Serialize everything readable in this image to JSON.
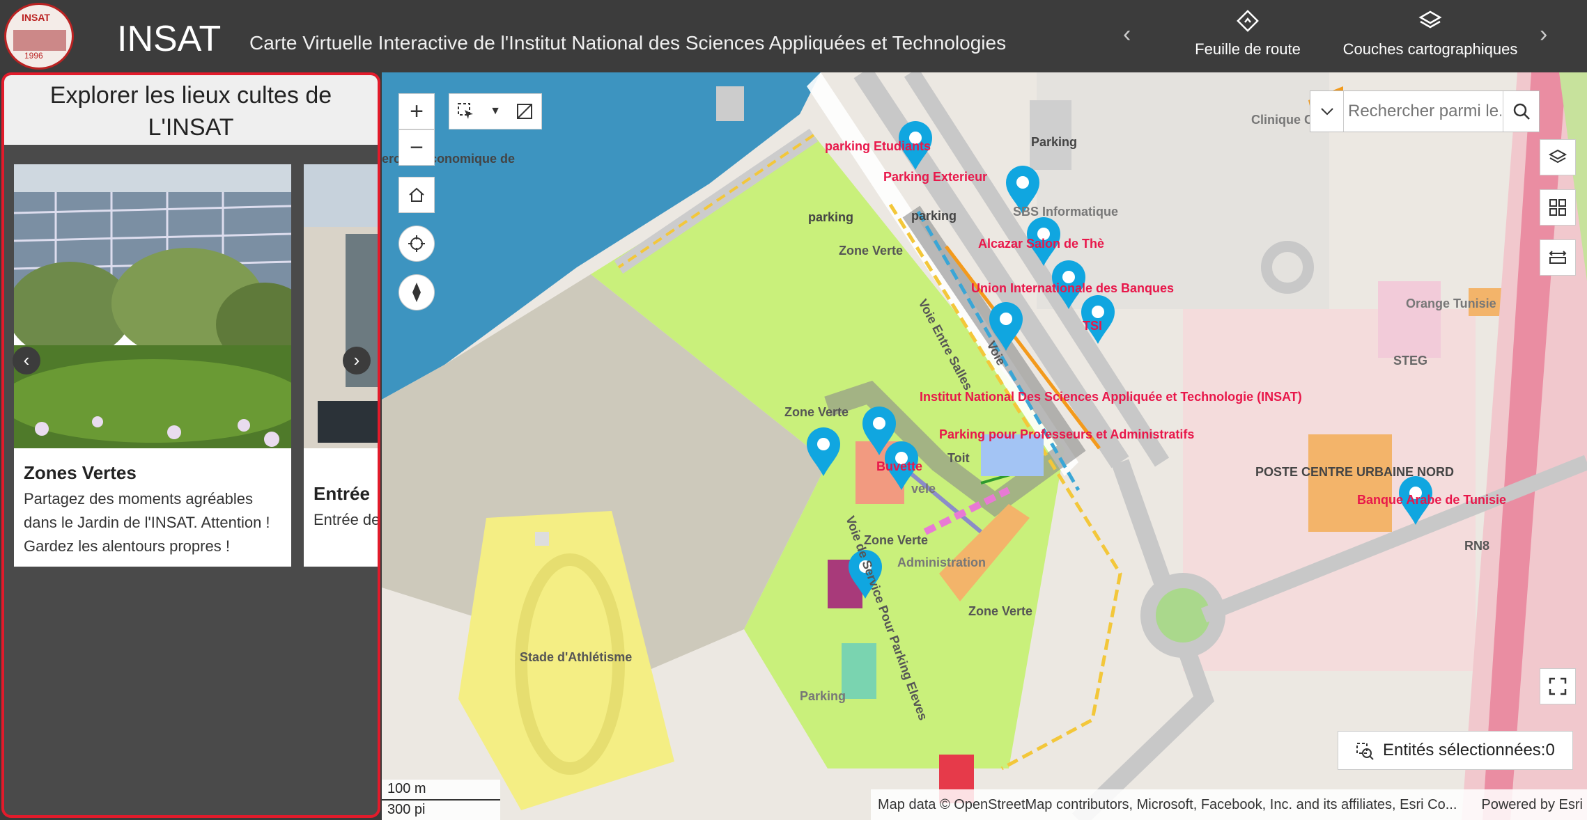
{
  "header": {
    "logo_text_top": "INSAT",
    "logo_text_year": "1996",
    "title": "INSAT",
    "subtitle": "Carte Virtuelle Interactive de l'Institut National des Sciences Appliquées et Technologies",
    "left_arrow": "‹",
    "right_arrow": "›",
    "buttons": [
      {
        "label": "Feuille de route",
        "icon": "roadmap-icon"
      },
      {
        "label": "Couches cartographiques",
        "icon": "layers-icon"
      }
    ]
  },
  "sidebar": {
    "title": "Explorer les lieux cultes de L'INSAT",
    "prev": "‹",
    "next": "›",
    "cards": [
      {
        "title": "Zones Vertes",
        "description": "Partagez des moments agréables dans le Jardin de l'INSAT. Attention ! Gardez les alentours propres !"
      },
      {
        "title": "Entrée",
        "description": "Entrée de dire bonjo"
      }
    ]
  },
  "map": {
    "search_placeholder": "Rechercher parmi le...",
    "selected_label": "Entités sélectionnées:0",
    "attribution": "Map data © OpenStreetMap contributors, Microsoft, Facebook, Inc. and its affiliates, Esri Co...",
    "powered_by": "Powered by Esri",
    "scale_m": "100 m",
    "scale_ft": "300 pi",
    "labels": {
      "parking_etudiants": "parking Etudiants",
      "parking_exterieur": "Parking Exterieur",
      "parking": "Parking",
      "parking_lc": "parking",
      "sbs": "SBS Informatique",
      "alcazar": "Alcazar Salon de Thè",
      "uib": "Union Internationale des Banques",
      "tsi": "TSI",
      "insat": "Institut National Des Sciences Appliquée et Technologie (INSAT)",
      "parking_prof": "Parking pour Professeurs et Administratifs",
      "buvette": "Buvette",
      "zone_verte": "Zone Verte",
      "toit": "Toit",
      "administration": "Administration",
      "stade": "Stade d'Athlétisme",
      "poste": "POSTE CENTRE URBAINE NORD",
      "bat": "Banque Arabe de Tunisie",
      "orange": "Orange Tunisie",
      "steg": "STEG",
      "clinique": "Clinique C",
      "rn8": "RN8",
      "eco": "ercice Économique de",
      "voie_entre": "Voie Entre Salles",
      "voie": "Voie",
      "voie_service": "Voie de Service Pour Parking Eleves",
      "vele": "vele"
    }
  }
}
